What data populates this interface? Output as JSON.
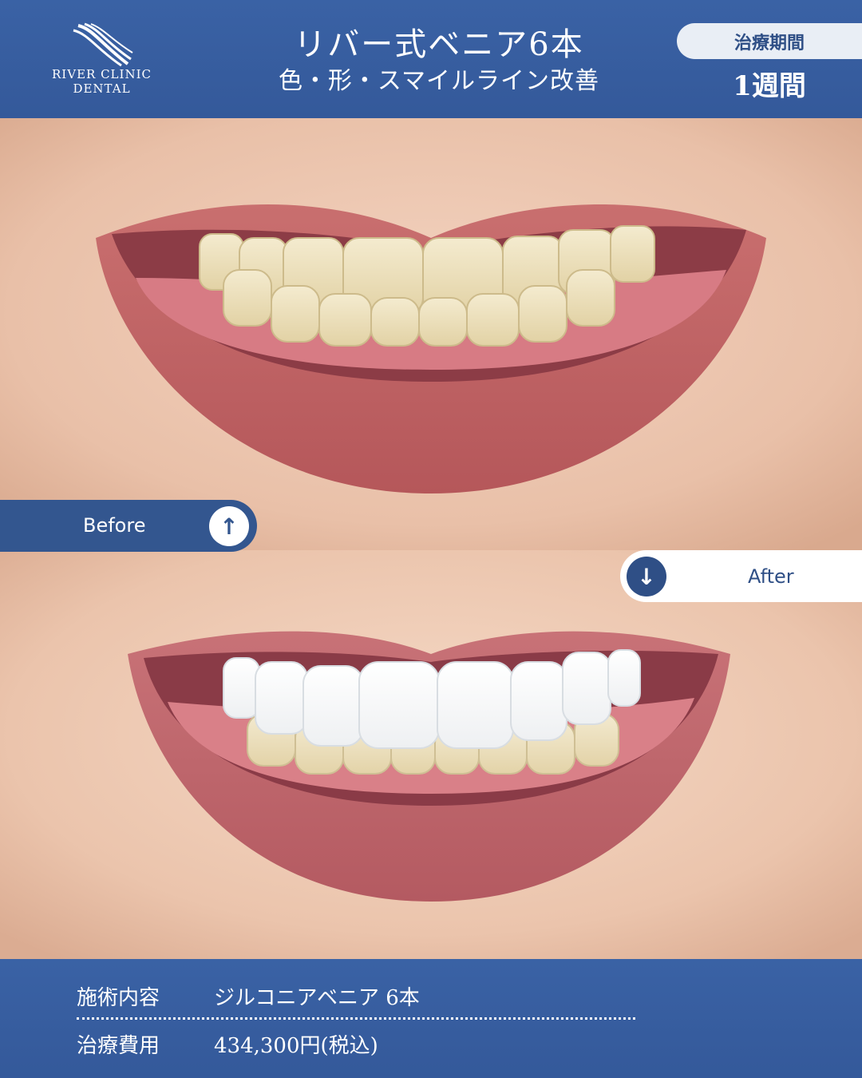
{
  "brand": {
    "name_line1": "RIVER CLINIC",
    "name_line2": "DENTAL"
  },
  "header": {
    "title": "リバー式ベニア6本",
    "subtitle": "色・形・スマイルライン改善",
    "period_label": "治療期間",
    "period_value": "1週間"
  },
  "labels": {
    "before": "Before",
    "after": "After",
    "before_icon": "arrow-up-icon",
    "after_icon": "arrow-down-icon",
    "before_arrow": "↑",
    "after_arrow": "↓"
  },
  "details": {
    "treatment_label": "施術内容",
    "treatment_value": "ジルコニアベニア 6本",
    "cost_label": "治療費用",
    "cost_value": "434,300円(税込)"
  },
  "colors": {
    "brand_blue": "#34599a",
    "label_dark": "#33568f",
    "pill_light": "#e9eef5"
  }
}
